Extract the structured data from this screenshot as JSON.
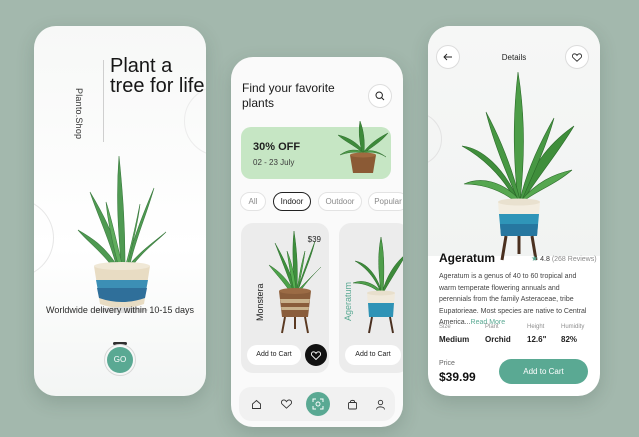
{
  "colors": {
    "accent": "#5aa993",
    "promo_bg": "#c6e6c4",
    "background": "#a3b8ad"
  },
  "splash": {
    "brand": "Planto.Shop",
    "headline": "Plant a tree for life",
    "delivery": "Worldwide delivery within 10-15 days",
    "go_label": "GO"
  },
  "home": {
    "title": "Find your favorite plants",
    "search_icon": "search-icon",
    "promo": {
      "title": "30% OFF",
      "dates": "02 - 23 July"
    },
    "chips": [
      "All",
      "Indoor",
      "Outdoor",
      "Popular"
    ],
    "active_chip": "Indoor",
    "cards": [
      {
        "name": "Monstera",
        "price": "$39",
        "add_label": "Add to Cart"
      },
      {
        "name": "Ageratum",
        "add_label": "Add to Cart"
      }
    ],
    "nav_icons": [
      "home-icon",
      "heart-icon",
      "scan-icon",
      "bag-icon",
      "user-icon"
    ]
  },
  "details": {
    "header": "Details",
    "name": "Ageratum",
    "rating": "4.8",
    "reviews": "(268 Reviews)",
    "description": "Ageratum is a genus of 40 to 60 tropical and warm temperate flowering annuals and perennials from the family Asteraceae, tribe Eupatorieae. Most species are native to Central America...",
    "read_more": "Read More",
    "specs": [
      {
        "label": "Size",
        "value": "Medium"
      },
      {
        "label": "Plant",
        "value": "Orchid"
      },
      {
        "label": "Height",
        "value": "12.6\""
      },
      {
        "label": "Humidity",
        "value": "82%"
      }
    ],
    "price_label": "Price",
    "price": "$39.99",
    "cart_label": "Add to Cart"
  }
}
